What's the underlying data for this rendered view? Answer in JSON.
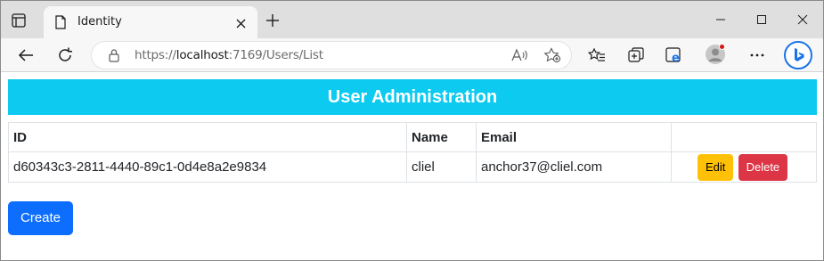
{
  "browser": {
    "tab": {
      "title": "Identity"
    },
    "address": {
      "scheme": "https://",
      "host": "localhost",
      "rest": ":7169/Users/List"
    }
  },
  "page": {
    "heading": "User Administration",
    "table": {
      "headers": {
        "id": "ID",
        "name": "Name",
        "email": "Email",
        "actions": ""
      },
      "rows": [
        {
          "id": "d60343c3-2811-4440-89c1-0d4e8a2e9834",
          "name": "cliel",
          "email": "anchor37@cliel.com",
          "edit_label": "Edit",
          "delete_label": "Delete"
        }
      ]
    },
    "create_label": "Create"
  },
  "colors": {
    "banner": "#0dcaf0",
    "edit_button": "#ffc107",
    "delete_button": "#dc3545",
    "create_button": "#0d6efd"
  },
  "icons": [
    "tab-actions-icon",
    "page-favicon-icon",
    "close-tab-icon",
    "new-tab-icon",
    "minimize-icon",
    "maximize-icon",
    "close-window-icon",
    "back-icon",
    "refresh-icon",
    "lock-icon",
    "read-aloud-icon",
    "add-favorite-icon",
    "favorites-icon",
    "collections-icon",
    "edge-icon",
    "profile-avatar-icon",
    "more-icon",
    "bing-icon"
  ]
}
